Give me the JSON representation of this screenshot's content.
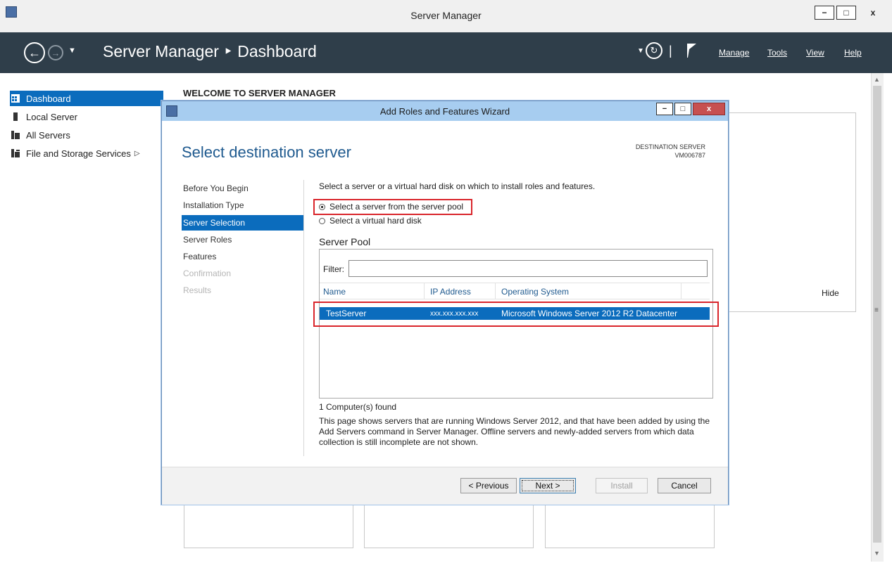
{
  "window": {
    "title": "Server Manager",
    "minimize": "−",
    "maximize": "□",
    "close": "x"
  },
  "header": {
    "breadcrumb": "Server Manager ‣ Dashboard",
    "refresh_separator": "|",
    "menus": [
      "Manage",
      "Tools",
      "View",
      "Help"
    ]
  },
  "sidebar": {
    "items": [
      {
        "label": "Dashboard",
        "icon": "dashboard-icon",
        "active": true
      },
      {
        "label": "Local Server",
        "icon": "server-icon",
        "active": false
      },
      {
        "label": "All Servers",
        "icon": "servers-icon",
        "active": false
      },
      {
        "label": "File and Storage Services",
        "icon": "storage-icon",
        "active": false,
        "expand": "▷"
      }
    ]
  },
  "main": {
    "welcome": "WELCOME TO SERVER MANAGER",
    "hide": "Hide"
  },
  "wizard": {
    "title": "Add Roles and Features Wizard",
    "heading": "Select destination server",
    "destination_label": "DESTINATION SERVER",
    "destination_value": "VM006787",
    "steps": [
      {
        "label": "Before You Begin",
        "state": "normal"
      },
      {
        "label": "Installation Type",
        "state": "normal"
      },
      {
        "label": "Server Selection",
        "state": "active"
      },
      {
        "label": "Server Roles",
        "state": "normal"
      },
      {
        "label": "Features",
        "state": "normal"
      },
      {
        "label": "Confirmation",
        "state": "disabled"
      },
      {
        "label": "Results",
        "state": "disabled"
      }
    ],
    "instruction": "Select a server or a virtual hard disk on which to install roles and features.",
    "option_pool": "Select a server from the server pool",
    "option_vhd": "Select a virtual hard disk",
    "pool_title": "Server Pool",
    "filter_label": "Filter:",
    "filter_value": "",
    "columns": [
      "Name",
      "IP Address",
      "Operating System"
    ],
    "rows": [
      {
        "name": "TestServer",
        "ip": "xxx.xxx.xxx.xxx",
        "os": "Microsoft Windows Server 2012 R2 Datacenter"
      }
    ],
    "found": "1 Computer(s) found",
    "description": "This page shows servers that are running Windows Server 2012, and that have been added by using the Add Servers command in Server Manager. Offline servers and newly-added servers from which data collection is still incomplete are not shown.",
    "buttons": {
      "previous": "< Previous",
      "next": "Next >",
      "install": "Install",
      "cancel": "Cancel"
    }
  },
  "colors": {
    "header_bg": "#2f3e4a",
    "accent": "#0b6cbd",
    "highlight_box": "#d9252b",
    "wizard_title_bg": "#a7cdf0"
  }
}
